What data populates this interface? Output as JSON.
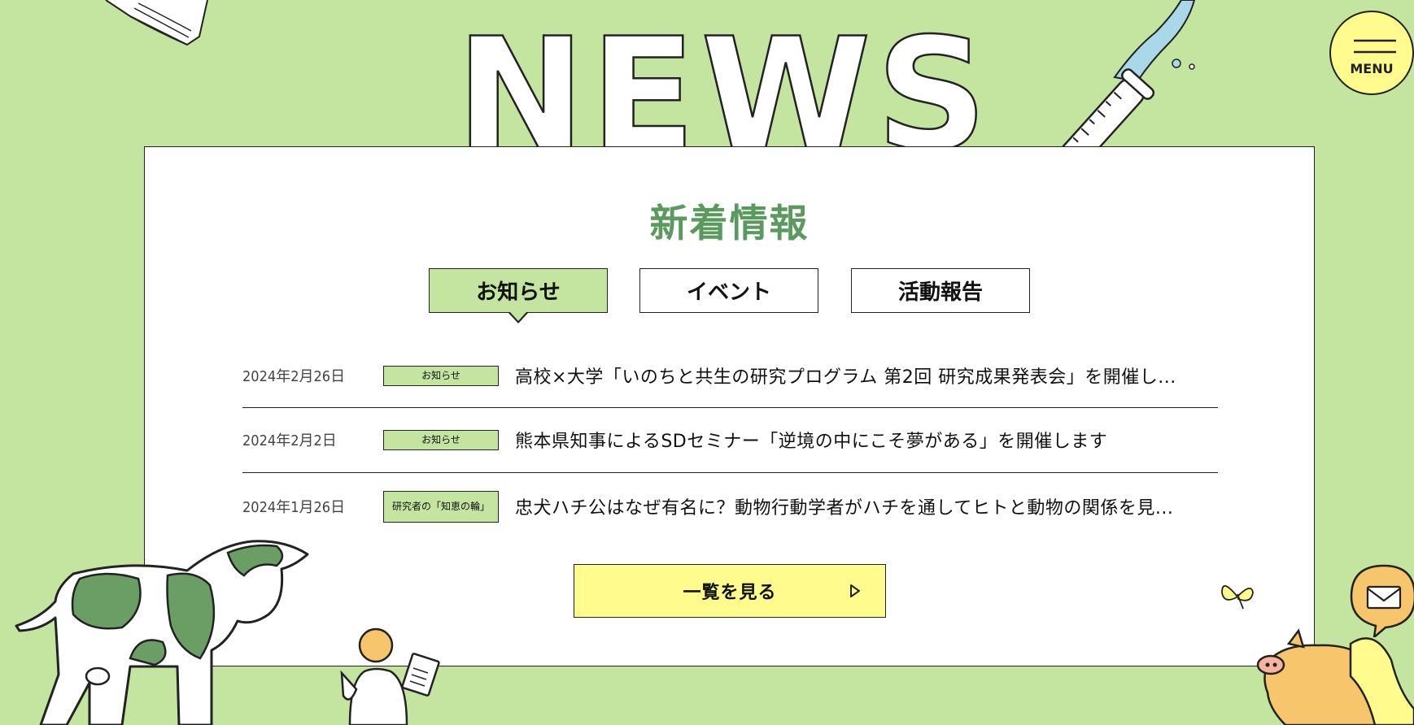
{
  "page": {
    "heading_en": "NEWS"
  },
  "panel": {
    "title": "新着情報"
  },
  "tabs": [
    {
      "label": "お知らせ",
      "active": true
    },
    {
      "label": "イベント",
      "active": false
    },
    {
      "label": "活動報告",
      "active": false
    }
  ],
  "news": [
    {
      "date": "2024年2月26日",
      "category": "お知らせ",
      "title": "高校×大学「いのちと共生の研究プログラム 第2回 研究成果発表会」を開催し..."
    },
    {
      "date": "2024年2月2日",
      "category": "お知らせ",
      "title": "熊本県知事によるSDセミナー「逆境の中にこそ夢がある」を開催します"
    },
    {
      "date": "2024年1月26日",
      "category": "研究者の「知恵の輪」",
      "title": "忠犬ハチ公はなぜ有名に？動物行動学者がハチを通してヒトと動物の関係を見..."
    }
  ],
  "view_all": {
    "label": "一覧を見る",
    "icon": "play-triangle-icon"
  },
  "menu": {
    "label": "MENU",
    "icon": "hamburger-icon"
  },
  "contact": {
    "icon": "mail-icon"
  },
  "colors": {
    "background": "#c3e5a0",
    "panel": "#ffffff",
    "accent_green": "#5b9a5e",
    "yellow": "#fffb8c",
    "orange": "#f7c56b",
    "cow_patch": "#6a9e64"
  }
}
